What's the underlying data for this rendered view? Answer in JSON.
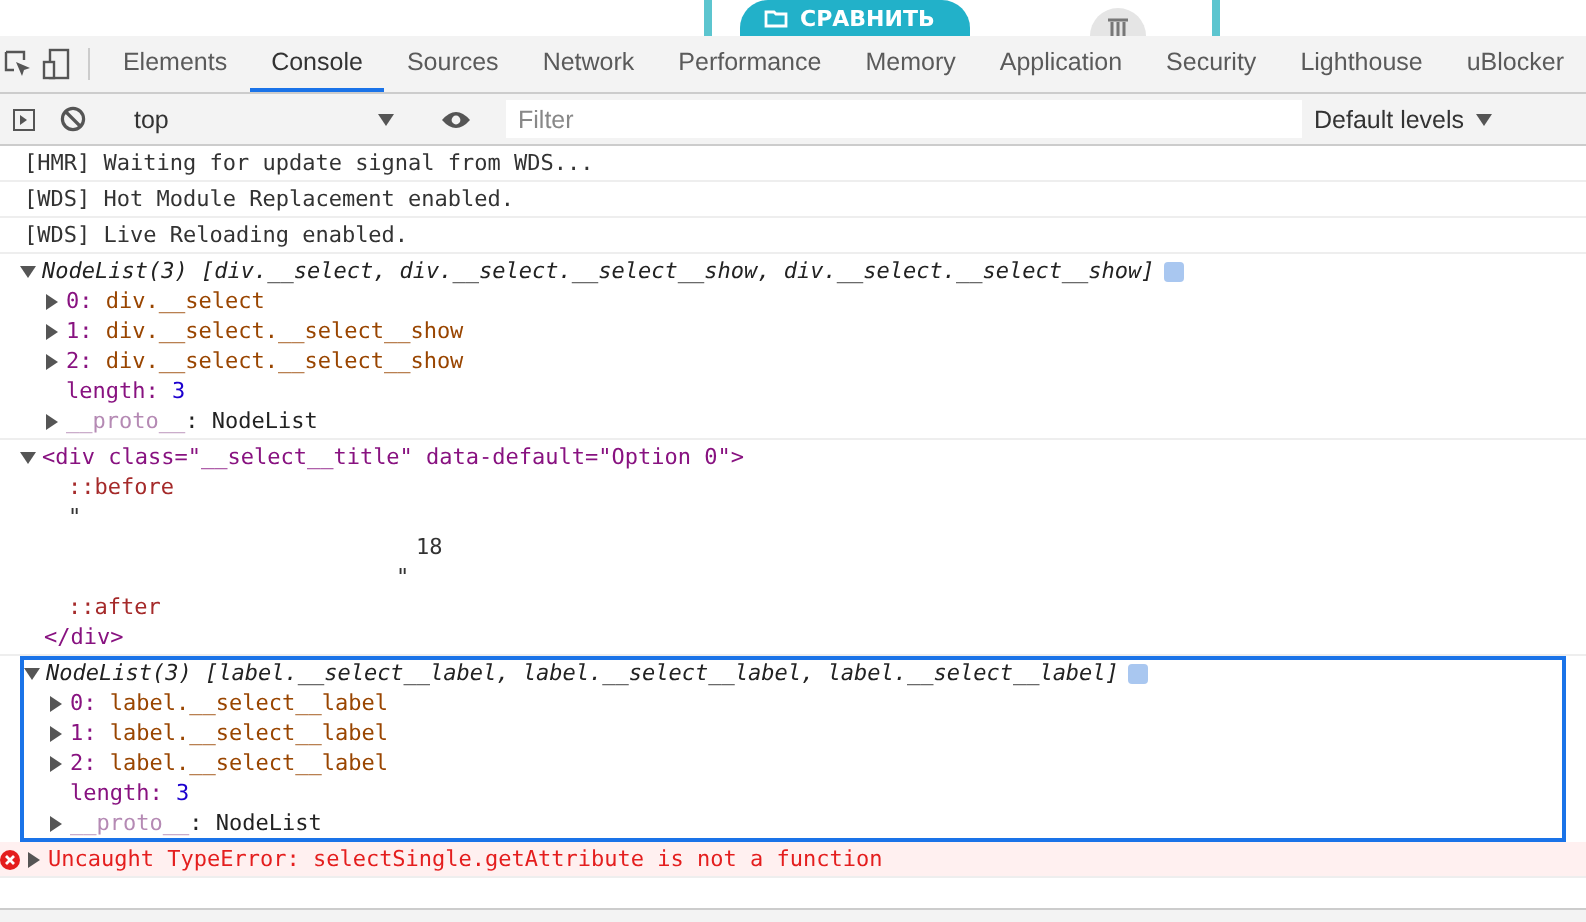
{
  "page_header": {
    "button": "СРАВНИТЬ"
  },
  "devtools_tabs": [
    {
      "label": "Elements",
      "selected": false
    },
    {
      "label": "Console",
      "selected": true
    },
    {
      "label": "Sources",
      "selected": false
    },
    {
      "label": "Network",
      "selected": false
    },
    {
      "label": "Performance",
      "selected": false
    },
    {
      "label": "Memory",
      "selected": false
    },
    {
      "label": "Application",
      "selected": false
    },
    {
      "label": "Security",
      "selected": false
    },
    {
      "label": "Lighthouse",
      "selected": false
    },
    {
      "label": "uBlocker",
      "selected": false
    }
  ],
  "toolbar": {
    "context": "top",
    "filter_placeholder": "Filter",
    "levels": "Default levels"
  },
  "messages": [
    {
      "kind": "log",
      "selected": false,
      "text": "[HMR] Waiting for update signal from WDS..."
    },
    {
      "kind": "log",
      "selected": false,
      "text": "[WDS] Hot Module Replacement enabled."
    },
    {
      "kind": "log",
      "selected": false,
      "text": "[WDS] Live Reloading enabled."
    },
    {
      "kind": "nodelist",
      "selected": false,
      "expanded": true,
      "summary": "NodeList(3) [div.__select, div.__select.__select__show, div.__select.__select__show]",
      "items": [
        {
          "key": "0:",
          "value": "div.__select"
        },
        {
          "key": "1:",
          "value": "div.__select.__select__show"
        },
        {
          "key": "2:",
          "value": "div.__select.__select__show"
        }
      ],
      "length": {
        "key": "length:",
        "value": "3"
      },
      "proto": {
        "key": "__proto__",
        "value": ": NodeList"
      }
    },
    {
      "kind": "element",
      "selected": false,
      "expanded": true,
      "lines": [
        {
          "kind": "tag",
          "text": "<div class=\"__select__title\" data-default=\"Option 0\">"
        },
        {
          "kind": "pseudo",
          "text": "::before"
        },
        {
          "kind": "text",
          "text": "\""
        },
        {
          "kind": "text_deep",
          "text": "18"
        },
        {
          "kind": "text_mid",
          "text": "\""
        },
        {
          "kind": "pseudo",
          "text": "::after"
        },
        {
          "kind": "close",
          "text": "</div>"
        }
      ]
    },
    {
      "kind": "nodelist",
      "selected": true,
      "expanded": true,
      "summary": "NodeList(3) [label.__select__label, label.__select__label, label.__select__label]",
      "items": [
        {
          "key": "0:",
          "value": "label.__select__label"
        },
        {
          "key": "1:",
          "value": "label.__select__label"
        },
        {
          "key": "2:",
          "value": "label.__select__label"
        }
      ],
      "length": {
        "key": "length:",
        "value": "3"
      },
      "proto": {
        "key": "__proto__",
        "value": ": NodeList"
      }
    },
    {
      "kind": "error",
      "selected": false,
      "expanded": false,
      "text": "Uncaught TypeError: selectSingle.getAttribute is not a function"
    }
  ]
}
